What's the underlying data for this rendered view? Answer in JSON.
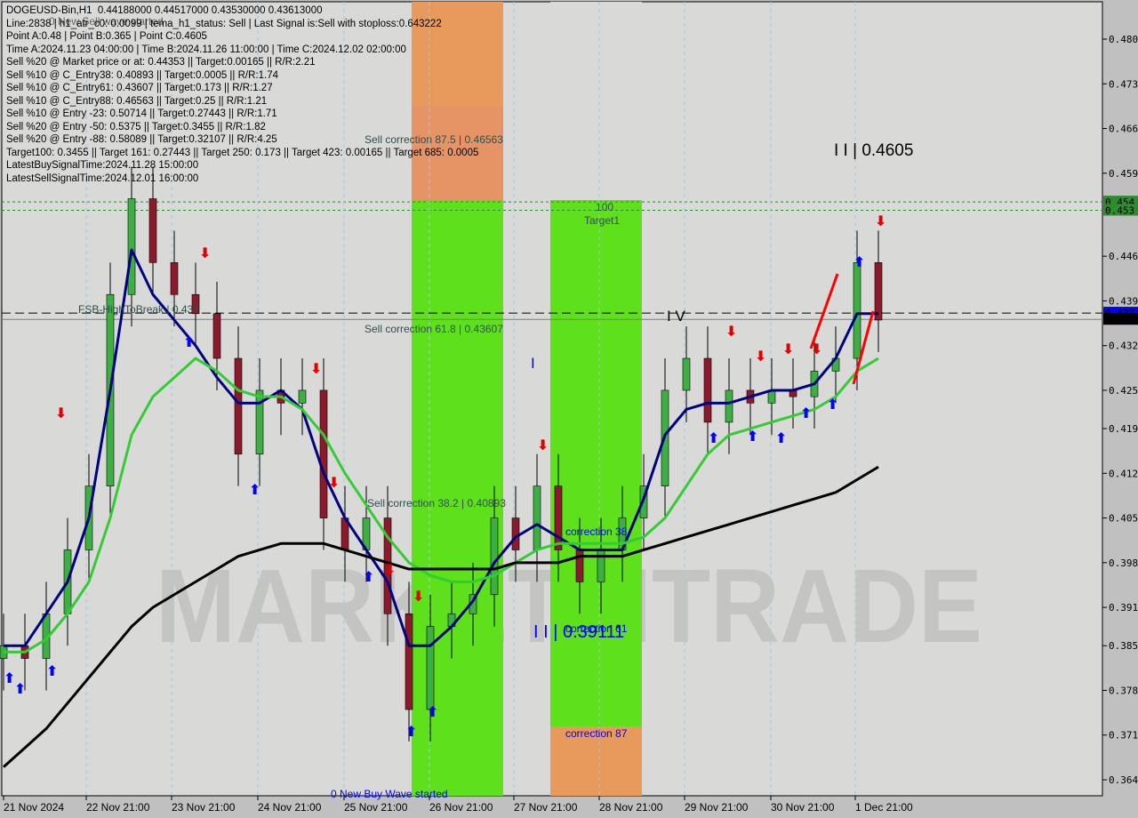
{
  "header": {
    "lines": [
      "DOGEUSD-Bin,H1  0.44188000 0.44517000 0.43530000 0.43613000",
      "Line:2838 | h1_atr_c0: 0.0099 | tema_h1_status: Sell | Last Signal is:Sell with stoploss:0.643222",
      "Point A:0.48 | Point B:0.365 | Point C:0.4605",
      "Time A:2024.11.23 04:00:00 | Time B:2024.11.26 11:00:00 | Time C:2024.12.02 02:00:00",
      "Sell %20 @ Market price or at: 0.44353 || Target:0.00165 || R/R:2.21",
      "Sell %10 @ C_Entry38: 0.40893 || Target:0.0005 || R/R:1.74",
      "Sell %10 @ C_Entry61: 0.43607 || Target:0.173 || R/R:1.27",
      "Sell %10 @ C_Entry88: 0.46563 || Target:0.25 || R/R:1.21",
      "Sell %10 @ Entry -23: 0.50714 || Target:0.27443 || R/R:1.71",
      "Sell %20 @ Entry -50: 0.5375 || Target:0.3455 || R/R:1.82",
      "Sell %20 @ Entry -88: 0.58089 || Target:0.32107 || R/R:4.25",
      "Target100: 0.3455 || Target 161: 0.27443 || Target 250: 0.173 || Target 423: 0.00165 || Target 685: 0.0005",
      "LatestBuySignalTime:2024.11.28 15:00:00",
      "LatestSellSignalTime:2024.12.01 16:00:00"
    ],
    "overlay_label": "0 New Sell wave started"
  },
  "annotations": {
    "sell_corr_875": "Sell correction 87.5 | 0.46563",
    "sell_corr_618": "Sell correction 61.8 | 0.43607",
    "sell_corr_382": "Sell correction 38.2 | 0.40893",
    "target_100": "100",
    "target1": "Target1",
    "fsb": "FSB-HighToBreak | 0.437",
    "corr_38": "correction 38",
    "corr_61": "correction 61",
    "corr_87": "correction 87",
    "point_b": "I I | 0.39111",
    "point_c": "I I | 0.4605",
    "wave_iv": "I V",
    "wave_i": "I",
    "new_buy": "0 New Buy Wave started",
    "watermark": "MARKETZITRADE"
  },
  "colors": {
    "background": "#d9d9d7",
    "bull": "#3cb043",
    "bear": "#8b1a2b",
    "ma_fast": "#000080",
    "ma_mid": "#33cc33",
    "ma_slow": "#000000",
    "zone_green": "#5ee01a",
    "zone_orange": "#e89a5c",
    "target_line": "#2e8b2e",
    "price_tag": "#0000ff"
  },
  "chart_data": {
    "type": "candlestick",
    "symbol": "DOGEUSD-Bin,H1",
    "ylim": [
      0.361,
      0.484
    ],
    "y_ticks": [
      "0.480",
      "0.473",
      "0.466",
      "0.459",
      "0.446",
      "0.439",
      "0.432",
      "0.425",
      "0.419",
      "0.412",
      "0.405",
      "0.398",
      "0.391",
      "0.385",
      "0.378",
      "0.371",
      "0.364"
    ],
    "x_tick_labels": [
      "21 Nov 2024",
      "22 Nov 21:00",
      "23 Nov 21:00",
      "24 Nov 21:00",
      "25 Nov 21:00",
      "26 Nov 21:00",
      "27 Nov 21:00",
      "28 Nov 21:00",
      "29 Nov 21:00",
      "30 Nov 21:00",
      "1 Dec 21:00"
    ],
    "price_tags": [
      {
        "label": "0.454",
        "value": 0.4545,
        "color": "#2e8b2e"
      },
      {
        "label": "0.453",
        "value": 0.4532,
        "color": "#2e8b2e"
      },
      {
        "label": "0.437",
        "value": 0.4371,
        "color": "#0000ff"
      },
      {
        "label": "0.436",
        "value": 0.4361,
        "color": "#000000"
      }
    ],
    "x": [
      "21 Nov 21:00",
      "22 Nov 03:00",
      "22 Nov 09:00",
      "22 Nov 15:00",
      "22 Nov 21:00",
      "23 Nov 03:00",
      "23 Nov 09:00",
      "23 Nov 15:00",
      "23 Nov 21:00",
      "24 Nov 03:00",
      "24 Nov 09:00",
      "24 Nov 15:00",
      "24 Nov 21:00",
      "25 Nov 03:00",
      "25 Nov 09:00",
      "25 Nov 15:00",
      "25 Nov 21:00",
      "26 Nov 03:00",
      "26 Nov 09:00",
      "26 Nov 15:00",
      "26 Nov 21:00",
      "27 Nov 03:00",
      "27 Nov 09:00",
      "27 Nov 15:00",
      "27 Nov 21:00",
      "28 Nov 03:00",
      "28 Nov 09:00",
      "28 Nov 15:00",
      "28 Nov 21:00",
      "29 Nov 03:00",
      "29 Nov 09:00",
      "29 Nov 15:00",
      "29 Nov 21:00",
      "30 Nov 03:00",
      "30 Nov 09:00",
      "30 Nov 15:00",
      "30 Nov 21:00",
      "1 Dec 03:00",
      "1 Dec 09:00",
      "1 Dec 15:00",
      "1 Dec 21:00",
      "2 Dec 03:00"
    ],
    "close": [
      0.385,
      0.383,
      0.39,
      0.4,
      0.41,
      0.44,
      0.455,
      0.445,
      0.44,
      0.437,
      0.43,
      0.415,
      0.425,
      0.423,
      0.425,
      0.405,
      0.4,
      0.405,
      0.39,
      0.375,
      0.388,
      0.39,
      0.393,
      0.405,
      0.4,
      0.41,
      0.4,
      0.395,
      0.4,
      0.405,
      0.41,
      0.425,
      0.43,
      0.42,
      0.425,
      0.423,
      0.425,
      0.424,
      0.428,
      0.43,
      0.445,
      0.436
    ],
    "series": [
      {
        "values": [
          0.385,
          0.385,
          0.39,
          0.395,
          0.405,
          0.425,
          0.447,
          0.44,
          0.436,
          0.432,
          0.427,
          0.423,
          0.423,
          0.425,
          0.422,
          0.412,
          0.405,
          0.4,
          0.395,
          0.385,
          0.385,
          0.388,
          0.392,
          0.398,
          0.402,
          0.404,
          0.402,
          0.4,
          0.4,
          0.4,
          0.408,
          0.418,
          0.422,
          0.423,
          0.423,
          0.424,
          0.425,
          0.425,
          0.426,
          0.43,
          0.437,
          0.437
        ],
        "color": "#000080"
      },
      {
        "values": [
          0.384,
          0.384,
          0.386,
          0.39,
          0.395,
          0.405,
          0.418,
          0.424,
          0.427,
          0.43,
          0.428,
          0.425,
          0.424,
          0.424,
          0.422,
          0.418,
          0.412,
          0.407,
          0.402,
          0.398,
          0.396,
          0.395,
          0.395,
          0.396,
          0.398,
          0.4,
          0.401,
          0.401,
          0.401,
          0.401,
          0.402,
          0.405,
          0.41,
          0.415,
          0.418,
          0.419,
          0.42,
          0.421,
          0.422,
          0.424,
          0.428,
          0.43
        ],
        "color": "#33cc33"
      },
      {
        "values": [
          0.366,
          0.369,
          0.372,
          0.376,
          0.38,
          0.384,
          0.388,
          0.391,
          0.393,
          0.395,
          0.397,
          0.399,
          0.4,
          0.401,
          0.401,
          0.401,
          0.4,
          0.399,
          0.398,
          0.397,
          0.397,
          0.397,
          0.397,
          0.397,
          0.398,
          0.398,
          0.398,
          0.399,
          0.399,
          0.399,
          0.4,
          0.401,
          0.402,
          0.403,
          0.404,
          0.405,
          0.406,
          0.407,
          0.408,
          0.409,
          0.411,
          0.413
        ],
        "color": "#000000"
      }
    ]
  }
}
